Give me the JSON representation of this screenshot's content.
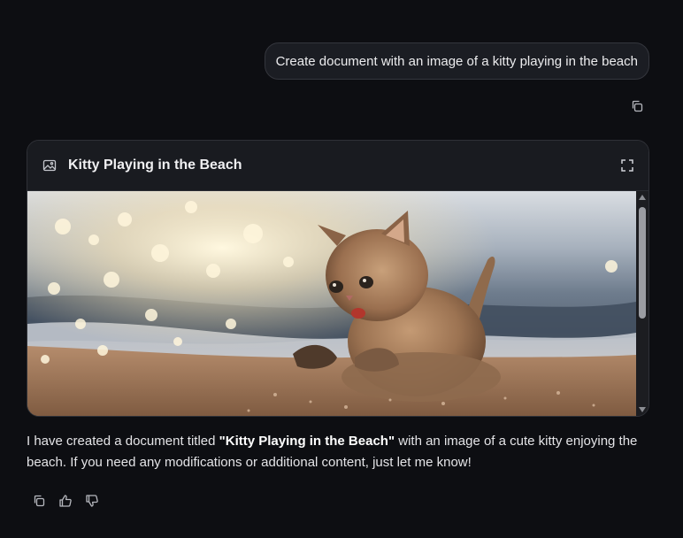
{
  "user_message": {
    "text": "Create document with an image of a kitty playing in the beach",
    "copy_icon": "copy-icon"
  },
  "document": {
    "title": "Kitty Playing in the Beach",
    "header_icon": "image-icon",
    "expand_icon": "expand-icon"
  },
  "assistant_message": {
    "prefix": "I have created a document titled ",
    "doc_title": "\"Kitty Playing in the Beach\"",
    "suffix": " with an image of a cute kitty enjoying the beach. If you need any modifications or additional content, just let me know!"
  },
  "actions": [
    {
      "icon": "copy-icon"
    },
    {
      "icon": "thumbs-up-icon"
    },
    {
      "icon": "thumbs-down-icon"
    }
  ],
  "colors": {
    "background": "#0d0e12",
    "bubble": "#1b1d23",
    "card": "#17191e",
    "border": "#2f3137"
  }
}
